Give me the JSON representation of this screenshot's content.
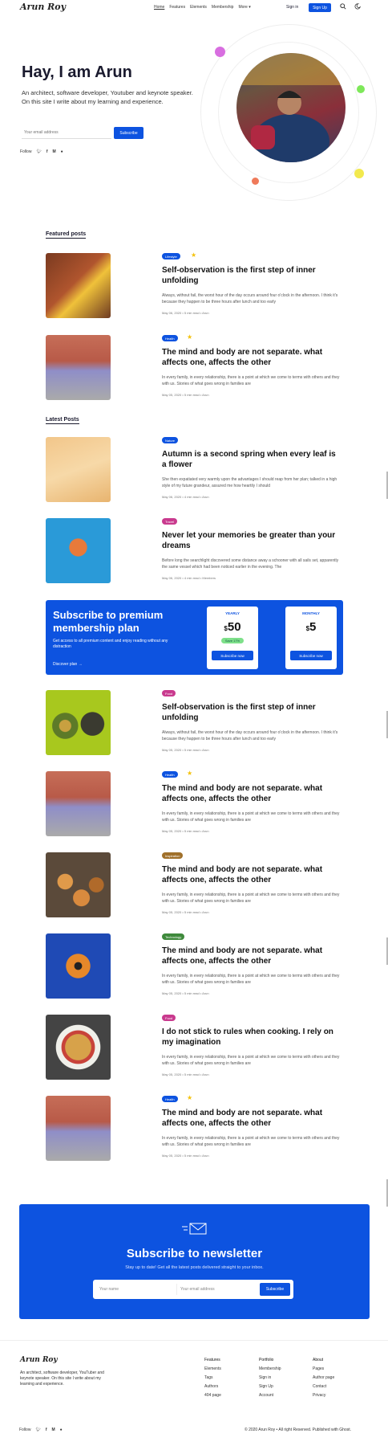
{
  "header": {
    "logo": "Arun Roy",
    "nav": [
      "Home",
      "Features",
      "Elements",
      "Membership",
      "More"
    ],
    "more_chevron": "chevron-down-icon",
    "signin": "Sign in",
    "signup": "Sign Up"
  },
  "hero": {
    "title": "Hay, I am Arun",
    "subtitle": "An architect, software developer, Youtuber and keynote speaker. On this site I write about my learning and experience.",
    "email_placeholder": "Your email address",
    "subscribe": "Subscribe",
    "follow_label": "Follow",
    "social_icons": [
      "twitter-icon",
      "facebook-icon",
      "medium-icon",
      "github-icon"
    ]
  },
  "featured": {
    "heading": "Featured posts",
    "posts": [
      {
        "tag": "Lifestyle",
        "tag_color": "#0d53e0",
        "featured": true,
        "title": "Self-observation is the first step of inner unfolding",
        "excerpt": "Always, without fail, the worst hour of the day occurs around four o'clock in the afternoon. I think it's because they happen to be three hours after lunch and too early",
        "meta": "May 06, 2020 • 5 min read • Arun"
      },
      {
        "tag": "Health",
        "tag_color": "#0d53e0",
        "featured": true,
        "title": "The mind and body are not separate. what affects one, affects the other",
        "excerpt": "In every family, in every relationship, there is a point at which we come to terms with others and they with us. Stories of what goes wrong in families are",
        "meta": "May 05, 2020 • 5 min read • Arun"
      }
    ]
  },
  "latest": {
    "heading": "Latest Posts",
    "posts": [
      {
        "tag": "Nature",
        "tag_color": "#0d53e0",
        "featured": false,
        "title": "Autumn is a second spring when every leaf is a flower",
        "excerpt": "She then expatiated very warmly upon the advantages I should reap from her plan; talked in a high style of my future grandeur, assured me how heartily I should",
        "meta": "May 06, 2020 • 4 min read • Arun"
      },
      {
        "tag": "Travel",
        "tag_color": "#c93a8e",
        "featured": false,
        "title": "Never let your memories be greater than your dreams",
        "excerpt": "Before long the searchlight discovered some distance away a schooner with all sails set, apparently the same vessel which had been noticed earlier in the evening. The",
        "meta": "May 06, 2020 • 4 min read • Members"
      },
      {
        "tag": "Food",
        "tag_color": "#c93a8e",
        "featured": false,
        "title": "Self-observation is the first step of inner unfolding",
        "excerpt": "Always, without fail, the worst hour of the day occurs around four o'clock in the afternoon. I think it's because they happen to be three hours after lunch and too early",
        "meta": "May 05, 2020 • 5 min read • Arun"
      },
      {
        "tag": "Health",
        "tag_color": "#0d53e0",
        "featured": true,
        "title": "The mind and body are not separate. what affects one, affects the other",
        "excerpt": "In every family, in every relationship, there is a point at which we come to terms with others and they with us. Stories of what goes wrong in families are",
        "meta": "May 05, 2020 • 5 min read • Arun"
      },
      {
        "tag": "Inspiration",
        "tag_color": "#a0702a",
        "featured": false,
        "title": "The mind and body are not separate. what affects one, affects the other",
        "excerpt": "In every family, in every relationship, there is a point at which we come to terms with others and they with us. Stories of what goes wrong in families are",
        "meta": "May 05, 2020 • 5 min read • Arun"
      },
      {
        "tag": "Technology",
        "tag_color": "#3f8a3c",
        "featured": false,
        "title": "The mind and body are not separate. what affects one, affects the other",
        "excerpt": "In every family, in every relationship, there is a point at which we come to terms with others and they with us. Stories of what goes wrong in families are",
        "meta": "May 05, 2020 • 5 min read • Arun"
      },
      {
        "tag": "Food",
        "tag_color": "#c93a8e",
        "featured": false,
        "title": "I do not stick to rules when cooking. I rely on my imagination",
        "excerpt": "In every family, in every relationship, there is a point at which we come to terms with others and they with us. Stories of what goes wrong in families are",
        "meta": "May 05, 2020 • 5 min read • Arun"
      },
      {
        "tag": "Health",
        "tag_color": "#0d53e0",
        "featured": true,
        "title": "The mind and body are not separate. what affects one, affects the other",
        "excerpt": "In every family, in every relationship, there is a point at which we come to terms with others and they with us. Stories of what goes wrong in families are",
        "meta": "May 05, 2020 • 5 min read • Arun"
      }
    ]
  },
  "premium": {
    "title": "Subscribe to premium membership plan",
    "subtitle": "Get access to all premium content and enjoy reading without any distraction",
    "link": "Discover plan →",
    "plans": [
      {
        "name": "YEARLY",
        "currency": "$",
        "price": "50",
        "badge": "Save 17%",
        "button": "Subscribe now"
      },
      {
        "name": "MONTHLY",
        "currency": "$",
        "price": "5",
        "badge": "",
        "button": "Subscribe now"
      }
    ]
  },
  "newsletter": {
    "icon": "envelope-icon",
    "title": "Subscribe to newsletter",
    "subtitle": "Stay up to date! Get all the latest posts delivered straight to your inbox.",
    "name_placeholder": "Your name",
    "email_placeholder": "Your email address",
    "button": "Subscribe"
  },
  "footer": {
    "logo": "Arun Roy",
    "description": "An architect, software developer, YouTuber and keynote speaker. On this site I write about my learning and experience.",
    "columns": [
      {
        "items": [
          "Features",
          "Elements",
          "Tags",
          "Authors",
          "404 page"
        ]
      },
      {
        "items": [
          "Portfolio",
          "Membership",
          "Sign in",
          "Sign Up",
          "Account"
        ]
      },
      {
        "items": [
          "About",
          "Pages",
          "Author page",
          "Contact",
          "Privacy"
        ]
      }
    ],
    "follow_label": "Follow",
    "copyright": "© 2020 Arun Roy • All right Reserved. Published with Ghost."
  },
  "colors": {
    "accent": "#0d53e0",
    "star": "#f4c20d"
  }
}
